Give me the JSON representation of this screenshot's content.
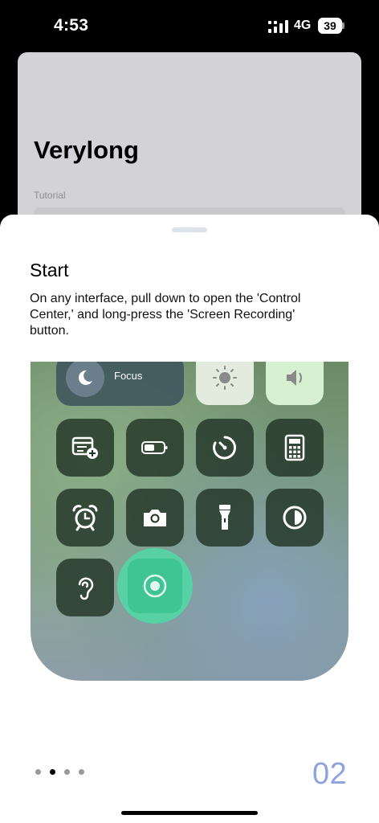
{
  "status_bar": {
    "time": "4:53",
    "network": "4G",
    "battery": "39"
  },
  "background": {
    "title": "Verylong",
    "subtitle": "Tutorial"
  },
  "sheet": {
    "title": "Start",
    "description": "On any interface, pull down to open the 'Control Center,' and long-press the 'Screen Recording' button."
  },
  "control_center": {
    "focus_label": "Focus",
    "tiles": [
      "brightness-icon",
      "volume-icon",
      "notes-add-icon",
      "battery-icon",
      "timer-icon",
      "calculator-icon",
      "alarm-icon",
      "camera-icon",
      "flashlight-icon",
      "dark-mode-icon",
      "hearing-icon",
      "screen-recording-icon"
    ],
    "highlight_color": "#52d6a6"
  },
  "pager": {
    "page_count": 4,
    "active_index": 1,
    "page_number": "02",
    "accent_color": "#8ea2e0"
  }
}
